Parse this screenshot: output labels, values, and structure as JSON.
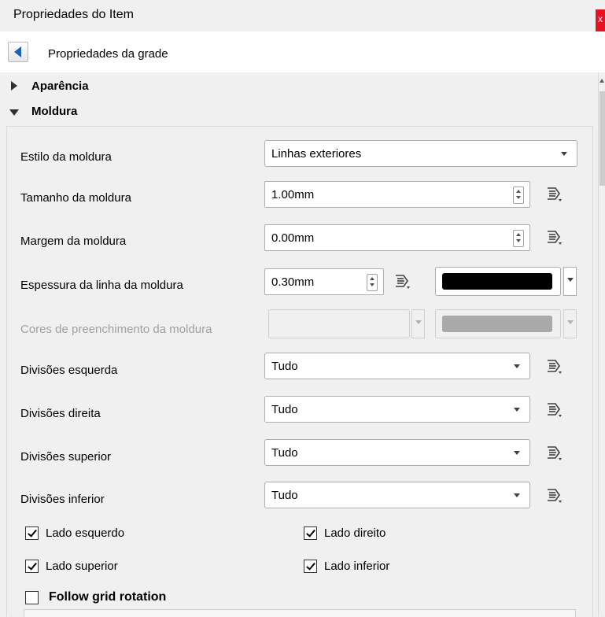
{
  "window": {
    "title": "Propriedades do Item",
    "close_glyph": "x"
  },
  "nav": {
    "back_label": "Propriedades da grade"
  },
  "sections": {
    "appearance": "Aparência",
    "frame": "Moldura"
  },
  "frame": {
    "style": {
      "label": "Estilo da moldura",
      "value": "Linhas exteriores"
    },
    "size": {
      "label": "Tamanho da moldura",
      "value": "1.00mm"
    },
    "margin": {
      "label": "Margem da moldura",
      "value": "0.00mm"
    },
    "line_width": {
      "label": "Espessura da linha da moldura",
      "value": "0.30mm",
      "color": "#000000"
    },
    "fill_colors": {
      "label": "Cores de preenchimento da moldura",
      "swatch": "#a9a9a9"
    },
    "div_left": {
      "label": "Divisões esquerda",
      "value": "Tudo"
    },
    "div_right": {
      "label": "Divisões direita",
      "value": "Tudo"
    },
    "div_top": {
      "label": "Divisões superior",
      "value": "Tudo"
    },
    "div_bottom": {
      "label": "Divisões inferior",
      "value": "Tudo"
    },
    "sides": {
      "left": {
        "label": "Lado esquerdo",
        "checked": true
      },
      "right": {
        "label": "Lado direito",
        "checked": true
      },
      "top": {
        "label": "Lado superior",
        "checked": true
      },
      "bottom": {
        "label": "Lado inferior",
        "checked": true
      }
    },
    "follow_rotation": {
      "label": "Follow grid rotation",
      "checked": false
    }
  },
  "icons": [
    "back-arrow-icon",
    "expand-arrow-icon",
    "collapse-arrow-icon",
    "data-defined-override-icon"
  ],
  "colors": {
    "back_arrow": "#1f5fb3",
    "close_button": "#e81123"
  }
}
